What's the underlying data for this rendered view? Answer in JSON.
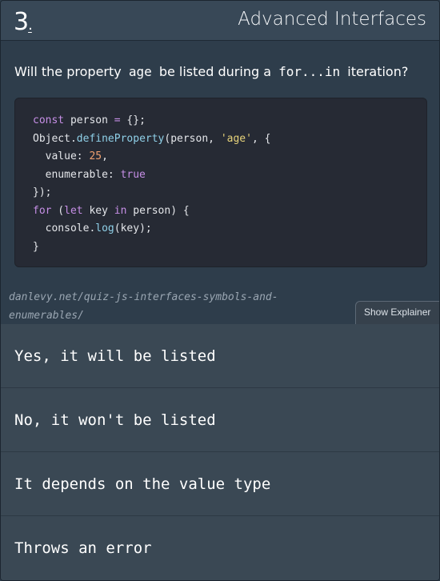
{
  "header": {
    "number": "3",
    "number_suffix": ".",
    "title": "Advanced Interfaces"
  },
  "question": {
    "prefix": "Will the property",
    "code1": "age",
    "middle": "be listed during a",
    "code2": "for...in",
    "suffix": "iteration?"
  },
  "code_lines": [
    "const person = {};",
    "Object.defineProperty(person, 'age', {",
    "  value: 25,",
    "  enumerable: true",
    "});",
    "for (let key in person) {",
    "  console.log(key);",
    "}"
  ],
  "source_link": {
    "line1": "danlevy.net/quiz-js-interfaces-symbols-and-",
    "line2": "enumerables/"
  },
  "explainer_button": "Show Explainer",
  "answers": [
    "Yes, it will be listed",
    "No, it won't be listed",
    "It depends on the value type",
    "Throws an error"
  ],
  "colors": {
    "header_bg": "#384857",
    "page_bg": "#2e3d4b",
    "code_bg": "#262a34",
    "answers_bg": "#3a4854",
    "keyword": "#c68fe6",
    "function": "#8fd0e8",
    "string": "#e6d27a",
    "number": "#f0a070"
  }
}
